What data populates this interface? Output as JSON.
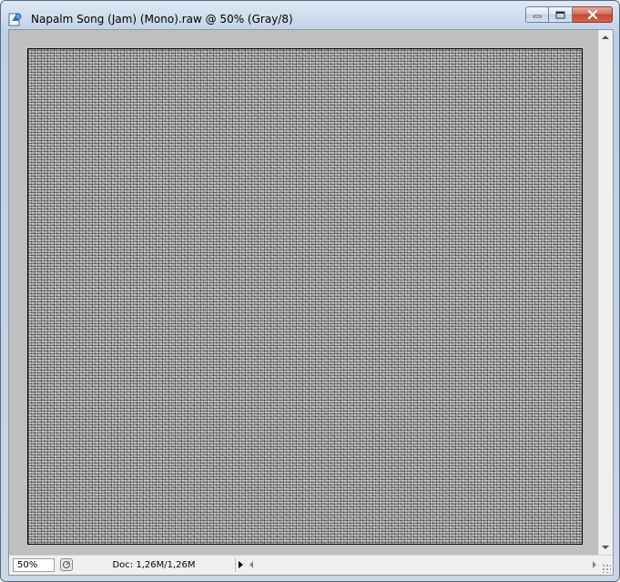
{
  "window": {
    "title": "Napalm Song (Jam) (Mono).raw @ 50% (Gray/8)",
    "app_icon": "photoshop-document-icon"
  },
  "caption_buttons": {
    "minimize_icon": "minimize-icon",
    "maximize_icon": "maximize-icon",
    "close_icon": "close-icon"
  },
  "canvas": {
    "image_description": "grayscale noise image",
    "color_mode": "Gray/8"
  },
  "statusbar": {
    "zoom": "50%",
    "doc_info": "Doc: 1,26M/1,26M",
    "status_icon": "status-info-icon"
  },
  "colors": {
    "canvas_background": "#bfbfbf",
    "image_border": "#000000",
    "close_button": "#c6462f"
  }
}
